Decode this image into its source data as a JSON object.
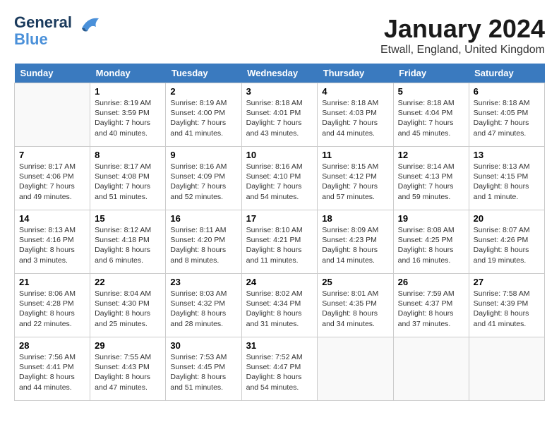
{
  "header": {
    "logo_line1": "General",
    "logo_line2": "Blue",
    "month_title": "January 2024",
    "location": "Etwall, England, United Kingdom"
  },
  "days": [
    "Sunday",
    "Monday",
    "Tuesday",
    "Wednesday",
    "Thursday",
    "Friday",
    "Saturday"
  ],
  "weeks": [
    [
      {
        "date": "",
        "sunrise": "",
        "sunset": "",
        "daylight": ""
      },
      {
        "date": "1",
        "sunrise": "Sunrise: 8:19 AM",
        "sunset": "Sunset: 3:59 PM",
        "daylight": "Daylight: 7 hours and 40 minutes."
      },
      {
        "date": "2",
        "sunrise": "Sunrise: 8:19 AM",
        "sunset": "Sunset: 4:00 PM",
        "daylight": "Daylight: 7 hours and 41 minutes."
      },
      {
        "date": "3",
        "sunrise": "Sunrise: 8:18 AM",
        "sunset": "Sunset: 4:01 PM",
        "daylight": "Daylight: 7 hours and 43 minutes."
      },
      {
        "date": "4",
        "sunrise": "Sunrise: 8:18 AM",
        "sunset": "Sunset: 4:03 PM",
        "daylight": "Daylight: 7 hours and 44 minutes."
      },
      {
        "date": "5",
        "sunrise": "Sunrise: 8:18 AM",
        "sunset": "Sunset: 4:04 PM",
        "daylight": "Daylight: 7 hours and 45 minutes."
      },
      {
        "date": "6",
        "sunrise": "Sunrise: 8:18 AM",
        "sunset": "Sunset: 4:05 PM",
        "daylight": "Daylight: 7 hours and 47 minutes."
      }
    ],
    [
      {
        "date": "7",
        "sunrise": "Sunrise: 8:17 AM",
        "sunset": "Sunset: 4:06 PM",
        "daylight": "Daylight: 7 hours and 49 minutes."
      },
      {
        "date": "8",
        "sunrise": "Sunrise: 8:17 AM",
        "sunset": "Sunset: 4:08 PM",
        "daylight": "Daylight: 7 hours and 51 minutes."
      },
      {
        "date": "9",
        "sunrise": "Sunrise: 8:16 AM",
        "sunset": "Sunset: 4:09 PM",
        "daylight": "Daylight: 7 hours and 52 minutes."
      },
      {
        "date": "10",
        "sunrise": "Sunrise: 8:16 AM",
        "sunset": "Sunset: 4:10 PM",
        "daylight": "Daylight: 7 hours and 54 minutes."
      },
      {
        "date": "11",
        "sunrise": "Sunrise: 8:15 AM",
        "sunset": "Sunset: 4:12 PM",
        "daylight": "Daylight: 7 hours and 57 minutes."
      },
      {
        "date": "12",
        "sunrise": "Sunrise: 8:14 AM",
        "sunset": "Sunset: 4:13 PM",
        "daylight": "Daylight: 7 hours and 59 minutes."
      },
      {
        "date": "13",
        "sunrise": "Sunrise: 8:13 AM",
        "sunset": "Sunset: 4:15 PM",
        "daylight": "Daylight: 8 hours and 1 minute."
      }
    ],
    [
      {
        "date": "14",
        "sunrise": "Sunrise: 8:13 AM",
        "sunset": "Sunset: 4:16 PM",
        "daylight": "Daylight: 8 hours and 3 minutes."
      },
      {
        "date": "15",
        "sunrise": "Sunrise: 8:12 AM",
        "sunset": "Sunset: 4:18 PM",
        "daylight": "Daylight: 8 hours and 6 minutes."
      },
      {
        "date": "16",
        "sunrise": "Sunrise: 8:11 AM",
        "sunset": "Sunset: 4:20 PM",
        "daylight": "Daylight: 8 hours and 8 minutes."
      },
      {
        "date": "17",
        "sunrise": "Sunrise: 8:10 AM",
        "sunset": "Sunset: 4:21 PM",
        "daylight": "Daylight: 8 hours and 11 minutes."
      },
      {
        "date": "18",
        "sunrise": "Sunrise: 8:09 AM",
        "sunset": "Sunset: 4:23 PM",
        "daylight": "Daylight: 8 hours and 14 minutes."
      },
      {
        "date": "19",
        "sunrise": "Sunrise: 8:08 AM",
        "sunset": "Sunset: 4:25 PM",
        "daylight": "Daylight: 8 hours and 16 minutes."
      },
      {
        "date": "20",
        "sunrise": "Sunrise: 8:07 AM",
        "sunset": "Sunset: 4:26 PM",
        "daylight": "Daylight: 8 hours and 19 minutes."
      }
    ],
    [
      {
        "date": "21",
        "sunrise": "Sunrise: 8:06 AM",
        "sunset": "Sunset: 4:28 PM",
        "daylight": "Daylight: 8 hours and 22 minutes."
      },
      {
        "date": "22",
        "sunrise": "Sunrise: 8:04 AM",
        "sunset": "Sunset: 4:30 PM",
        "daylight": "Daylight: 8 hours and 25 minutes."
      },
      {
        "date": "23",
        "sunrise": "Sunrise: 8:03 AM",
        "sunset": "Sunset: 4:32 PM",
        "daylight": "Daylight: 8 hours and 28 minutes."
      },
      {
        "date": "24",
        "sunrise": "Sunrise: 8:02 AM",
        "sunset": "Sunset: 4:34 PM",
        "daylight": "Daylight: 8 hours and 31 minutes."
      },
      {
        "date": "25",
        "sunrise": "Sunrise: 8:01 AM",
        "sunset": "Sunset: 4:35 PM",
        "daylight": "Daylight: 8 hours and 34 minutes."
      },
      {
        "date": "26",
        "sunrise": "Sunrise: 7:59 AM",
        "sunset": "Sunset: 4:37 PM",
        "daylight": "Daylight: 8 hours and 37 minutes."
      },
      {
        "date": "27",
        "sunrise": "Sunrise: 7:58 AM",
        "sunset": "Sunset: 4:39 PM",
        "daylight": "Daylight: 8 hours and 41 minutes."
      }
    ],
    [
      {
        "date": "28",
        "sunrise": "Sunrise: 7:56 AM",
        "sunset": "Sunset: 4:41 PM",
        "daylight": "Daylight: 8 hours and 44 minutes."
      },
      {
        "date": "29",
        "sunrise": "Sunrise: 7:55 AM",
        "sunset": "Sunset: 4:43 PM",
        "daylight": "Daylight: 8 hours and 47 minutes."
      },
      {
        "date": "30",
        "sunrise": "Sunrise: 7:53 AM",
        "sunset": "Sunset: 4:45 PM",
        "daylight": "Daylight: 8 hours and 51 minutes."
      },
      {
        "date": "31",
        "sunrise": "Sunrise: 7:52 AM",
        "sunset": "Sunset: 4:47 PM",
        "daylight": "Daylight: 8 hours and 54 minutes."
      },
      {
        "date": "",
        "sunrise": "",
        "sunset": "",
        "daylight": ""
      },
      {
        "date": "",
        "sunrise": "",
        "sunset": "",
        "daylight": ""
      },
      {
        "date": "",
        "sunrise": "",
        "sunset": "",
        "daylight": ""
      }
    ]
  ]
}
